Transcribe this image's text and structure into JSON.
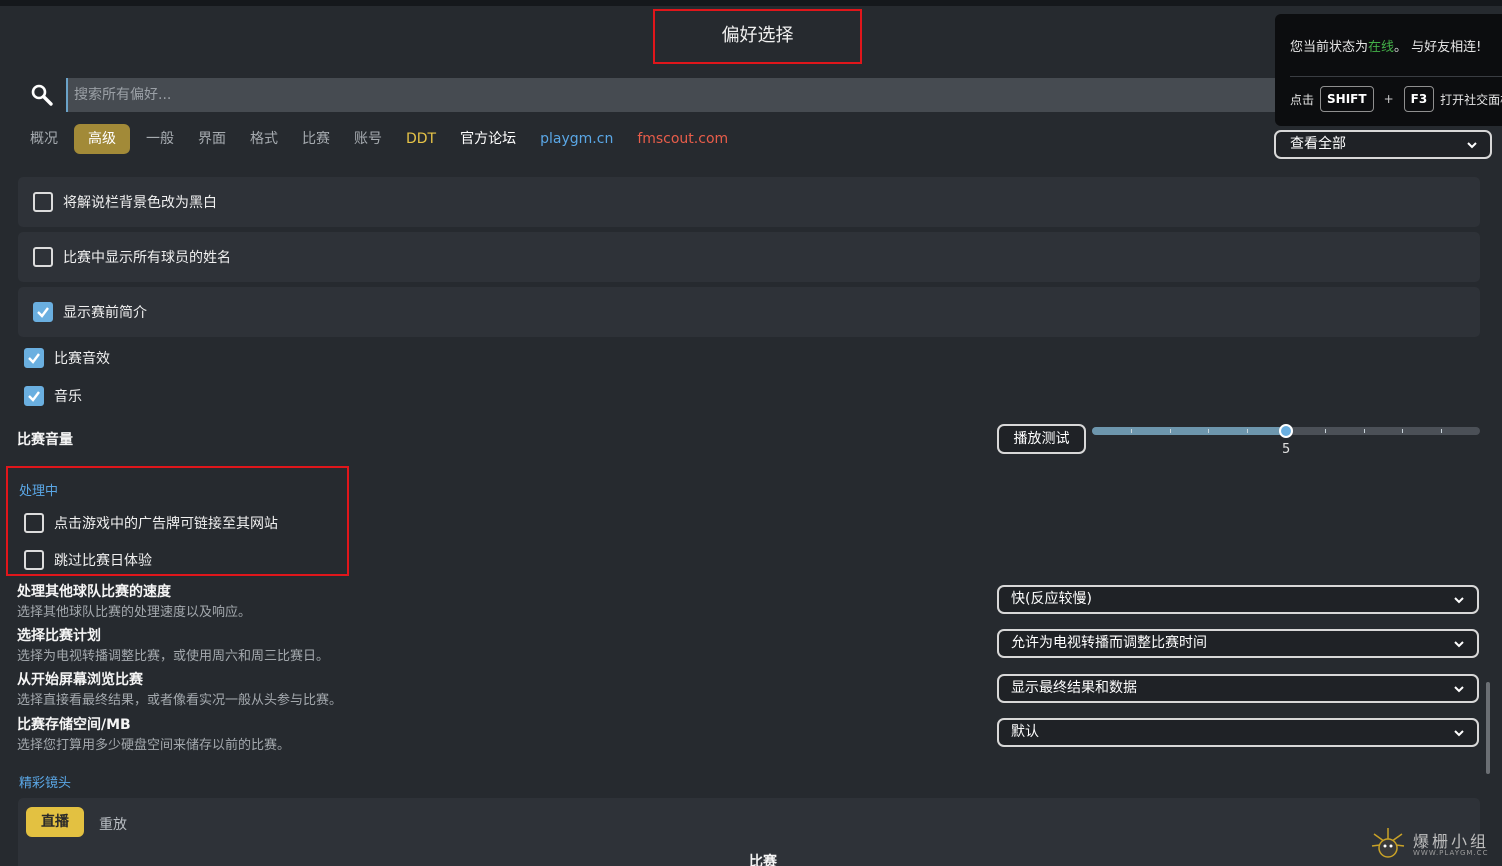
{
  "page": {
    "title": "偏好选择"
  },
  "search": {
    "placeholder": "搜索所有偏好..."
  },
  "tabs": [
    {
      "label": "概况"
    },
    {
      "label": "高级",
      "active": true
    },
    {
      "label": "一般"
    },
    {
      "label": "界面"
    },
    {
      "label": "格式"
    },
    {
      "label": "比赛"
    },
    {
      "label": "账号"
    },
    {
      "label": "DDT",
      "color": "#e7c447"
    },
    {
      "label": "官方论坛",
      "color": "#ffffff"
    },
    {
      "label": "playgm.cn",
      "color": "#5aa7e6"
    },
    {
      "label": "fmscout.com",
      "color": "#e85d4a"
    }
  ],
  "filter": {
    "selected": "查看全部"
  },
  "notification": {
    "status_prefix": "您当前状态为",
    "status_value": "在线",
    "status_suffix": "。 与好友相连!",
    "hint_prefix": "点击",
    "key1": "SHIFT",
    "plus": "+",
    "key2": "F3",
    "hint_suffix": "打开社交面板"
  },
  "options": {
    "bw_commentary": {
      "label": "将解说栏背景色改为黑白",
      "checked": false
    },
    "all_player_names": {
      "label": "比赛中显示所有球员的姓名",
      "checked": false
    },
    "pre_match_intro": {
      "label": "显示赛前简介",
      "checked": true
    },
    "match_sfx": {
      "label": "比赛音效",
      "checked": true
    },
    "music": {
      "label": "音乐",
      "checked": true
    }
  },
  "volume": {
    "label": "比赛音量",
    "play_test_label": "播放测试",
    "value": 5,
    "min": 0,
    "max": 10,
    "display": "5"
  },
  "processing": {
    "section_title": "处理中",
    "ad_links": {
      "label": "点击游戏中的广告牌可链接至其网站",
      "checked": false
    },
    "skip_matchday": {
      "label": "跳过比赛日体验",
      "checked": false
    }
  },
  "settings": [
    {
      "title": "处理其他球队比赛的速度",
      "desc": "选择其他球队比赛的处理速度以及响应。",
      "value": "快(反应较慢)"
    },
    {
      "title": "选择比赛计划",
      "desc": "选择为电视转播调整比赛，或使用周六和周三比赛日。",
      "value": "允许为电视转播而调整比赛时间"
    },
    {
      "title": "从开始屏幕浏览比赛",
      "desc": "选择直接看最终结果，或者像看实况一般从头参与比赛。",
      "value": "显示最终结果和数据"
    },
    {
      "title": "比赛存储空间/MB",
      "desc": "选择您打算用多少硬盘空间来储存以前的比赛。",
      "value": "默认"
    }
  ],
  "highlights": {
    "section_title": "精彩镜头",
    "live_label": "直播",
    "replay_label": "重放",
    "match_label": "比赛"
  },
  "watermark": {
    "text": "爆栅小组",
    "sub": "WWW.PLAYGM.CC"
  }
}
